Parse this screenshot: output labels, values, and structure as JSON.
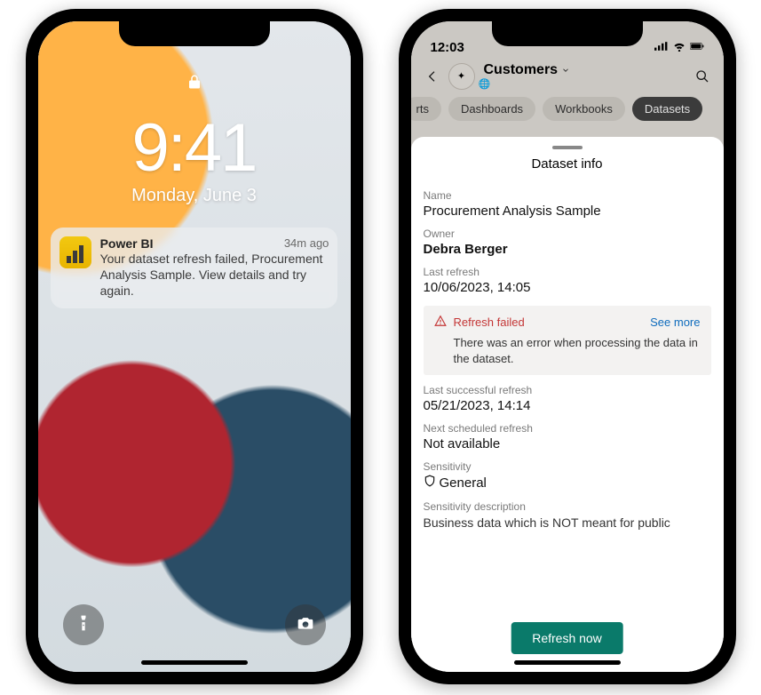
{
  "phone1": {
    "clock": "9:41",
    "date": "Monday, June 3",
    "notification": {
      "app": "Power BI",
      "time": "34m ago",
      "message": "Your dataset refresh failed, Procurement Analysis Sample. View details and try again."
    }
  },
  "phone2": {
    "status": {
      "time": "12:03"
    },
    "header": {
      "title": "Customers"
    },
    "tabs": {
      "t0": "rts",
      "t1": "Dashboards",
      "t2": "Workbooks",
      "t3": "Datasets"
    },
    "sheet": {
      "title": "Dataset info",
      "labels": {
        "name": "Name",
        "owner": "Owner",
        "last_refresh": "Last refresh",
        "last_success": "Last successful refresh",
        "next": "Next scheduled refresh",
        "sensitivity": "Sensitivity",
        "sensitivity_desc": "Sensitivity description"
      },
      "values": {
        "name": "Procurement Analysis Sample",
        "owner": "Debra Berger",
        "last_refresh": "10/06/2023, 14:05",
        "last_success": "05/21/2023, 14:14",
        "next": "Not available",
        "sensitivity": "General",
        "sensitivity_desc": "Business data which is NOT meant for public"
      },
      "error": {
        "title": "Refresh failed",
        "link": "See more",
        "message": "There was an error when processing the data in the dataset."
      },
      "refresh_button": "Refresh now"
    }
  }
}
